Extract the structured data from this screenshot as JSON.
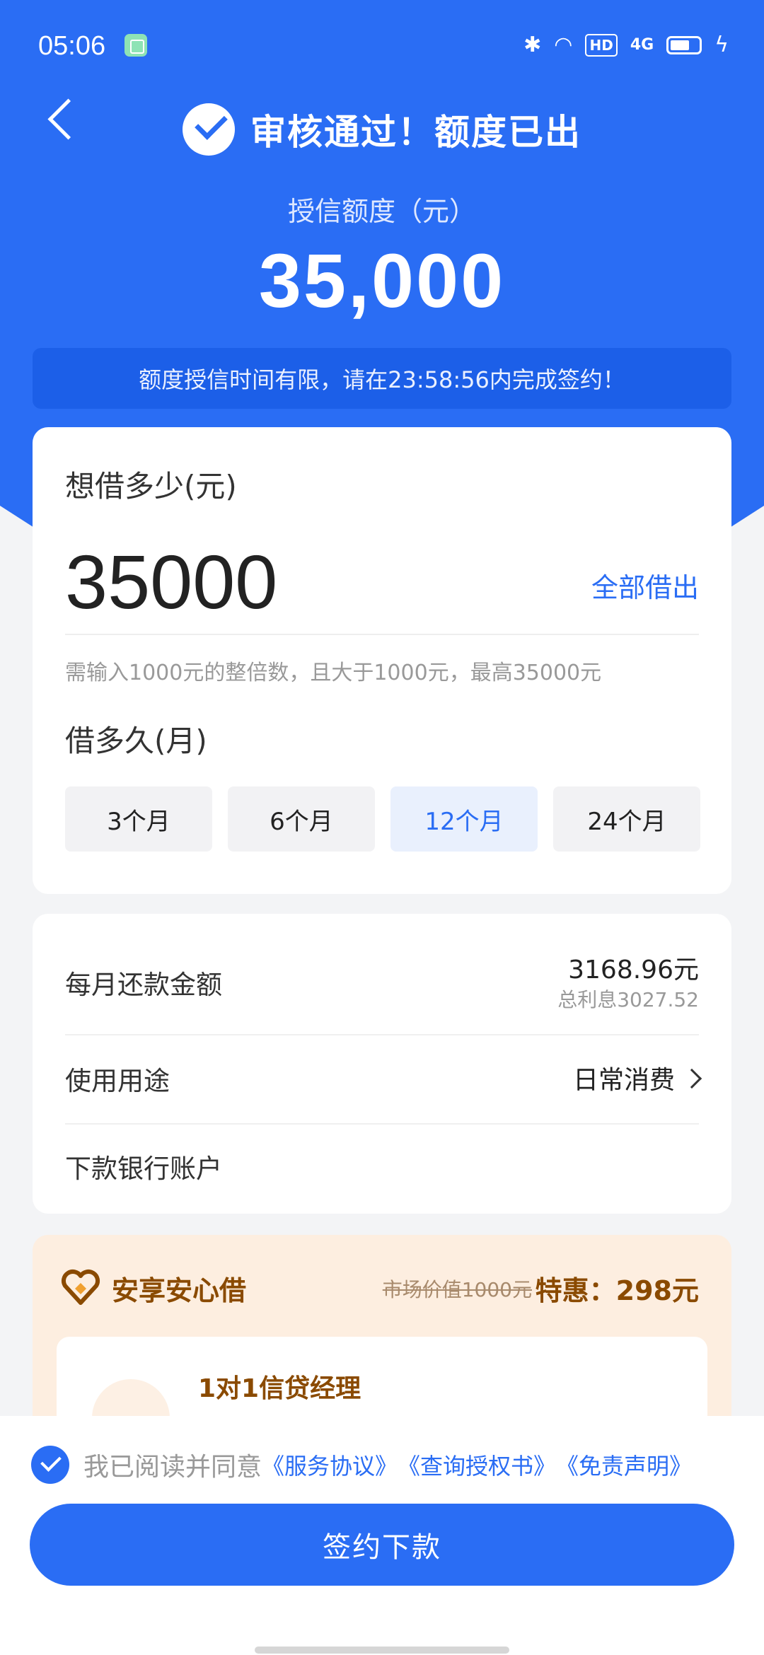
{
  "status_bar": {
    "time": "05:06",
    "network": "4G",
    "hd": "HD"
  },
  "header": {
    "title": "审核通过！额度已出",
    "credit_label": "授信额度（元）",
    "credit_amount": "35,000",
    "notice": "额度授信时间有限，请在23:58:56内完成签约！"
  },
  "loan": {
    "amount_label": "想借多少(元)",
    "amount_value": "35000",
    "borrow_all": "全部借出",
    "hint": "需输入1000元的整倍数，且大于1000元，最高35000元",
    "term_label": "借多久(月)",
    "terms": [
      "3个月",
      "6个月",
      "12个月",
      "24个月"
    ],
    "selected_term": "12个月"
  },
  "details": {
    "monthly_label": "每月还款金额",
    "monthly_value": "3168.96元",
    "total_interest": "总利息3027.52",
    "purpose_label": "使用用途",
    "purpose_value": "日常消费",
    "account_label": "下款银行账户"
  },
  "promo": {
    "title": "安享安心借",
    "market_price": "市场价值1000元",
    "offer": "特惠：298元",
    "item_title": "1对1信贷经理"
  },
  "footer": {
    "agree_text": "我已阅读并同意",
    "agreements": [
      "《服务协议》",
      "《查询授权书》",
      "《免责声明》"
    ],
    "sign_button": "签约下款"
  },
  "colors": {
    "primary": "#2a6df4",
    "promo_brown": "#8a4a00",
    "promo_bg": "#fdeee0"
  }
}
